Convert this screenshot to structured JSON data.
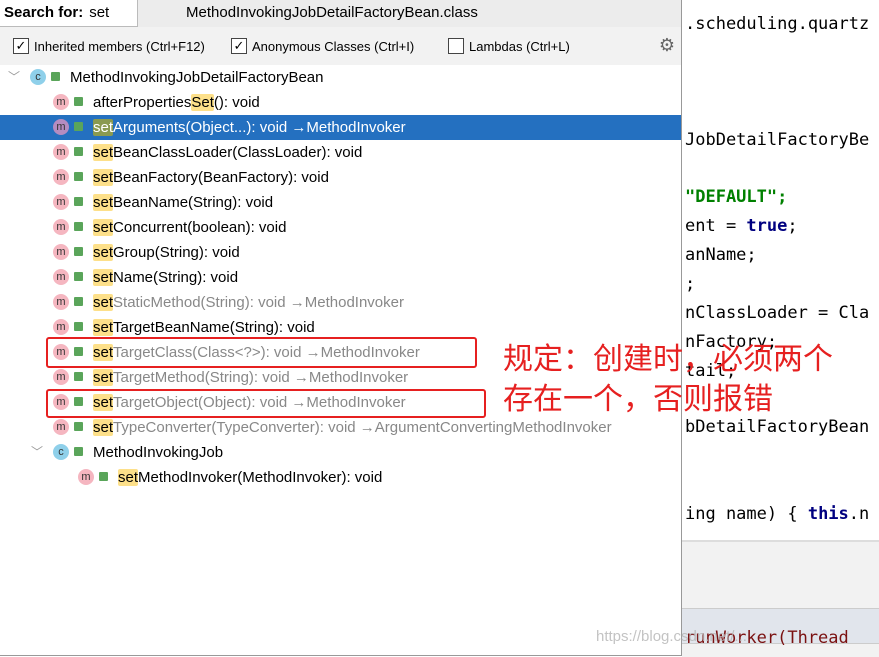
{
  "search": {
    "label": "Search for:",
    "value": "set"
  },
  "title": "MethodInvokingJobDetailFactoryBean.class",
  "options": [
    {
      "label": "Inherited members (Ctrl+F12)",
      "checked": true
    },
    {
      "label": "Anonymous Classes (Ctrl+I)",
      "checked": true
    },
    {
      "label": "Lambdas (Ctrl+L)",
      "checked": false
    }
  ],
  "tree": [
    {
      "kind": "class",
      "level": 0,
      "pre": "",
      "hl": "",
      "post": "MethodInvokingJobDetailFactoryBean",
      "suffix": "",
      "inherited": false
    },
    {
      "kind": "method",
      "level": 1,
      "pre": "afterProperties",
      "hl": "Set",
      "post": "(): void",
      "suffix": "",
      "inherited": false
    },
    {
      "kind": "method",
      "level": 1,
      "pre": "",
      "hl": "set",
      "post": "Arguments(Object...): void",
      "suffix": " →MethodInvoker",
      "inherited": false,
      "selected": true
    },
    {
      "kind": "method",
      "level": 1,
      "pre": "",
      "hl": "set",
      "post": "BeanClassLoader(ClassLoader): void",
      "suffix": "",
      "inherited": false
    },
    {
      "kind": "method",
      "level": 1,
      "pre": "",
      "hl": "set",
      "post": "BeanFactory(BeanFactory): void",
      "suffix": "",
      "inherited": false
    },
    {
      "kind": "method",
      "level": 1,
      "pre": "",
      "hl": "set",
      "post": "BeanName(String): void",
      "suffix": "",
      "inherited": false
    },
    {
      "kind": "method",
      "level": 1,
      "pre": "",
      "hl": "set",
      "post": "Concurrent(boolean): void",
      "suffix": "",
      "inherited": false
    },
    {
      "kind": "method",
      "level": 1,
      "pre": "",
      "hl": "set",
      "post": "Group(String): void",
      "suffix": "",
      "inherited": false
    },
    {
      "kind": "method",
      "level": 1,
      "pre": "",
      "hl": "set",
      "post": "Name(String): void",
      "suffix": "",
      "inherited": false
    },
    {
      "kind": "method",
      "level": 1,
      "pre": "",
      "hl": "set",
      "post": "StaticMethod(String): void",
      "suffix": " →MethodInvoker",
      "inherited": true
    },
    {
      "kind": "method",
      "level": 1,
      "pre": "",
      "hl": "set",
      "post": "TargetBeanName(String): void",
      "suffix": "",
      "inherited": false
    },
    {
      "kind": "method",
      "level": 1,
      "pre": "",
      "hl": "set",
      "post": "TargetClass(Class<?>): void",
      "suffix": " →MethodInvoker",
      "inherited": true
    },
    {
      "kind": "method",
      "level": 1,
      "pre": "",
      "hl": "set",
      "post": "TargetMethod(String): void",
      "suffix": " →MethodInvoker",
      "inherited": true
    },
    {
      "kind": "method",
      "level": 1,
      "pre": "",
      "hl": "set",
      "post": "TargetObject(Object): void",
      "suffix": " →MethodInvoker",
      "inherited": true
    },
    {
      "kind": "method",
      "level": 1,
      "pre": "",
      "hl": "set",
      "post": "TypeConverter(TypeConverter): void",
      "suffix": " →ArgumentConvertingMethodInvoker",
      "inherited": true
    },
    {
      "kind": "class",
      "level": 1,
      "pre": "",
      "hl": "",
      "post": "MethodInvokingJob",
      "suffix": "",
      "inherited": false
    },
    {
      "kind": "method",
      "level": 2,
      "pre": "",
      "hl": "set",
      "post": "MethodInvoker(MethodInvoker): void",
      "suffix": "",
      "inherited": false
    }
  ],
  "code": [
    ".scheduling.quartz",
    "JobDetailFactoryBe",
    "\"DEFAULT\";",
    "ent = ",
    "true",
    ";",
    "anName;",
    ";",
    "nClassLoader = Cla",
    "nFactory;",
    "tail;",
    "bDetailFactoryBean",
    "ing name) { ",
    "this",
    ".n",
    "runWorker(Thread"
  ],
  "annotation": [
    "规定：创建时，必须两个",
    "存在一个，否则报错"
  ],
  "watermark": "https://blog.csdn.net/..."
}
